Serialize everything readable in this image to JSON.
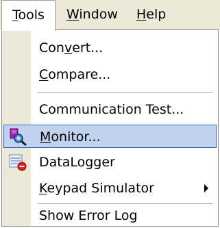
{
  "menubar": {
    "items": [
      {
        "pre": "",
        "mnemonic": "T",
        "post": "ools"
      },
      {
        "pre": "",
        "mnemonic": "W",
        "post": "indow"
      },
      {
        "pre": "",
        "mnemonic": "H",
        "post": "elp"
      }
    ]
  },
  "menu": {
    "items": [
      {
        "pre": "Con",
        "mnemonic": "v",
        "post": "ert..."
      },
      {
        "pre": "",
        "mnemonic": "C",
        "post": "ompare..."
      },
      {
        "pre": "Communication Test...",
        "mnemonic": "",
        "post": ""
      },
      {
        "pre": "",
        "mnemonic": "M",
        "post": "onitor...",
        "icon": "monitor-icon",
        "highlighted": true
      },
      {
        "pre": "DataLogger",
        "mnemonic": "",
        "post": "",
        "icon": "datalogger-icon"
      },
      {
        "pre": "",
        "mnemonic": "K",
        "post": "eypad Simulator",
        "submenu": true
      },
      {
        "pre": "Show Error Log",
        "mnemonic": "",
        "post": ""
      }
    ]
  },
  "colors": {
    "menubar_bg": "#ece9d8",
    "highlight_bg": "#c1d2ee",
    "highlight_border": "#316ac5"
  }
}
